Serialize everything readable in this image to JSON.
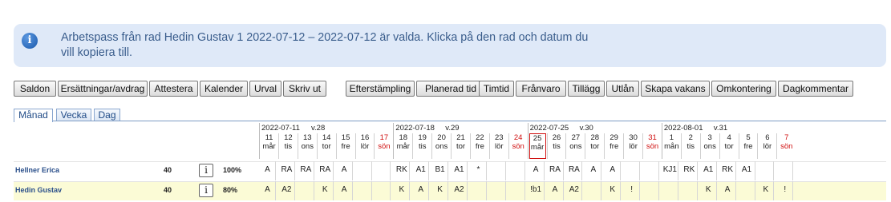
{
  "info": {
    "text_line1": "Arbetspass från rad Hedin Gustav 1 2022-07-12 – 2022-07-12 är valda. Klicka på den rad och datum du",
    "text_line2": "vill kopiera till.",
    "icon_symbol": "i"
  },
  "toolbar_left": [
    "Saldon",
    "Ersättningar/avdrag",
    "Attestera",
    "Kalender",
    "Urval",
    "Skriv ut"
  ],
  "toolbar_right": [
    "Efterstämpling",
    "Planerad tid",
    "Timtid",
    "Frånvaro",
    "Tillägg",
    "Utlån",
    "Skapa vakans",
    "Omkontering",
    "Dagkommentar"
  ],
  "tabs": [
    "Månad",
    "Vecka",
    "Dag"
  ],
  "active_tab": "Månad",
  "weeks": [
    {
      "start": "2022-07-11",
      "num": "v.28"
    },
    {
      "start": "2022-07-18",
      "num": "v.29"
    },
    {
      "start": "2022-07-25",
      "num": "v.30"
    },
    {
      "start": "2022-08-01",
      "num": "v.31"
    }
  ],
  "days": [
    {
      "d": "11",
      "w": "mår"
    },
    {
      "d": "12",
      "w": "tis"
    },
    {
      "d": "13",
      "w": "ons"
    },
    {
      "d": "14",
      "w": "tor"
    },
    {
      "d": "15",
      "w": "fre"
    },
    {
      "d": "16",
      "w": "lör"
    },
    {
      "d": "17",
      "w": "sön",
      "sun": true
    },
    {
      "d": "18",
      "w": "mår"
    },
    {
      "d": "19",
      "w": "tis"
    },
    {
      "d": "20",
      "w": "ons"
    },
    {
      "d": "21",
      "w": "tor"
    },
    {
      "d": "22",
      "w": "fre"
    },
    {
      "d": "23",
      "w": "lör"
    },
    {
      "d": "24",
      "w": "sön",
      "sun": true
    },
    {
      "d": "25",
      "w": "mår",
      "today": true
    },
    {
      "d": "26",
      "w": "tis"
    },
    {
      "d": "27",
      "w": "ons"
    },
    {
      "d": "28",
      "w": "tor"
    },
    {
      "d": "29",
      "w": "fre"
    },
    {
      "d": "30",
      "w": "lör"
    },
    {
      "d": "31",
      "w": "sön",
      "sun": true
    },
    {
      "d": "1",
      "w": "mån"
    },
    {
      "d": "2",
      "w": "tis"
    },
    {
      "d": "3",
      "w": "ons"
    },
    {
      "d": "4",
      "w": "tor"
    },
    {
      "d": "5",
      "w": "fre"
    },
    {
      "d": "6",
      "w": "lör"
    },
    {
      "d": "7",
      "w": "sön",
      "sun": true
    }
  ],
  "employees": [
    {
      "name": "Hellner Erica",
      "hours": "40",
      "info": "i",
      "pct": "100%",
      "highlight": false,
      "cells": [
        "A",
        "RA",
        "RA",
        "RA",
        "A",
        "",
        "",
        "RK",
        "A1",
        "B1",
        "A1",
        "*",
        "",
        "",
        "A",
        "RA",
        "RA",
        "A",
        "A",
        "",
        "",
        "KJ1",
        "RK",
        "A1",
        "RK",
        "A1",
        "",
        ""
      ]
    },
    {
      "name": "Hedin Gustav",
      "hours": "40",
      "info": "i",
      "pct": "80%",
      "highlight": true,
      "cells": [
        "A",
        "A2",
        "",
        "K",
        "A",
        "",
        "",
        "K",
        "A",
        "K",
        "A2",
        "",
        "",
        "",
        "!b1",
        "A",
        "A2",
        "",
        "K",
        "!",
        "",
        "",
        "",
        "K",
        "A",
        "",
        "K",
        "!"
      ]
    }
  ],
  "colors": {
    "info_bg": "#dfe9f8",
    "highlight_row": "#fbfbd6",
    "sunday": "#d01010",
    "name_link": "#2a4f8a"
  }
}
